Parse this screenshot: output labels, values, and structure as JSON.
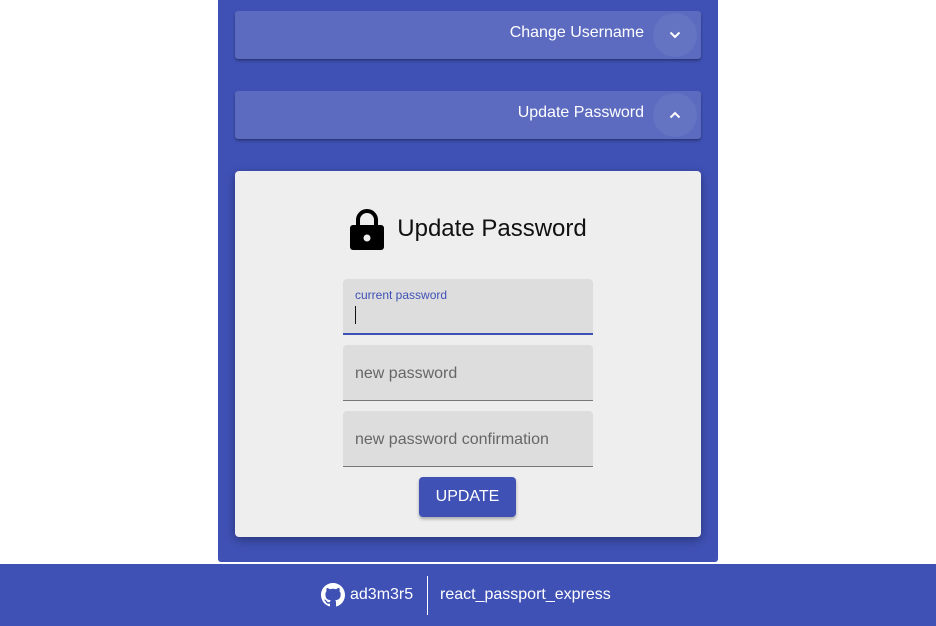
{
  "accordions": {
    "change_username": {
      "label": "Change Username",
      "expanded": false
    },
    "update_password": {
      "label": "Update Password",
      "expanded": true
    }
  },
  "form": {
    "title": "Update Password",
    "icon": "lock-icon",
    "fields": {
      "current_password": {
        "label": "current password",
        "value": ""
      },
      "new_password": {
        "placeholder": "new password",
        "value": ""
      },
      "new_password_confirmation": {
        "placeholder": "new password confirmation",
        "value": ""
      }
    },
    "submit_label": "UPDATE"
  },
  "footer": {
    "user_icon": "github-icon",
    "username": "ad3m3r5",
    "repo": "react_passport_express"
  },
  "colors": {
    "primary": "#3f51b5",
    "accordion": "#5c6bc0",
    "card": "#eeeeee",
    "field": "#dddddd"
  }
}
